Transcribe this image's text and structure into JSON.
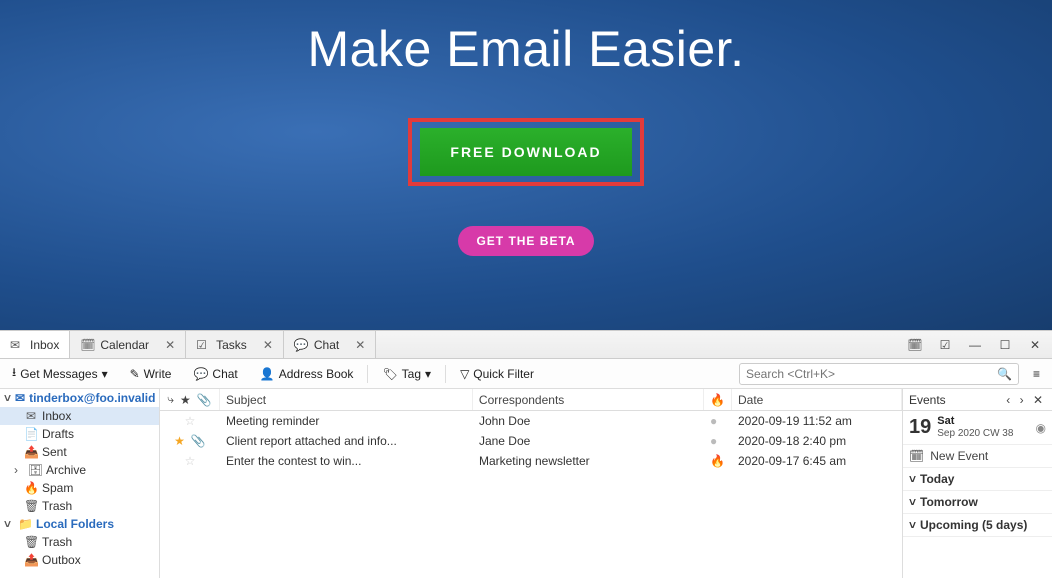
{
  "hero": {
    "title": "Make Email Easier.",
    "download_label": "FREE DOWNLOAD",
    "beta_label": "GET THE BETA"
  },
  "tabs": [
    {
      "label": "Inbox",
      "icon": "mail",
      "active": true,
      "closable": false
    },
    {
      "label": "Calendar",
      "icon": "calendar",
      "active": false,
      "closable": true
    },
    {
      "label": "Tasks",
      "icon": "tasks",
      "active": false,
      "closable": true
    },
    {
      "label": "Chat",
      "icon": "chat",
      "active": false,
      "closable": true
    }
  ],
  "toolbar": {
    "get_messages": "Get Messages",
    "write": "Write",
    "chat": "Chat",
    "address_book": "Address Book",
    "tag": "Tag",
    "quick_filter": "Quick Filter",
    "search_placeholder": "Search <Ctrl+K>"
  },
  "folders": {
    "account": "tinderbox@foo.invalid",
    "items": [
      {
        "label": "Inbox",
        "icon": "mail",
        "selected": true
      },
      {
        "label": "Drafts",
        "icon": "draft",
        "selected": false
      },
      {
        "label": "Sent",
        "icon": "sent",
        "selected": false
      },
      {
        "label": "Archive",
        "icon": "archive",
        "selected": false,
        "expandable": true
      },
      {
        "label": "Spam",
        "icon": "spam",
        "selected": false
      },
      {
        "label": "Trash",
        "icon": "trash",
        "selected": false
      }
    ],
    "local_label": "Local Folders",
    "local_items": [
      {
        "label": "Trash",
        "icon": "trash"
      },
      {
        "label": "Outbox",
        "icon": "outbox"
      }
    ]
  },
  "messages": {
    "columns": {
      "subject": "Subject",
      "correspondents": "Correspondents",
      "date": "Date"
    },
    "rows": [
      {
        "star": false,
        "attach": false,
        "subject": "Meeting reminder",
        "corr": "John Doe",
        "flag": "dim",
        "date": "2020-09-19 11:52 am"
      },
      {
        "star": true,
        "attach": true,
        "subject": "Client report attached and info...",
        "corr": "Jane Doe",
        "flag": "dim",
        "date": "2020-09-18 2:40 pm"
      },
      {
        "star": false,
        "attach": false,
        "subject": "Enter the contest to win...",
        "corr": "Marketing newsletter",
        "flag": "on",
        "date": "2020-09-17 6:45 am"
      }
    ]
  },
  "events": {
    "title": "Events",
    "day": "19",
    "weekday": "Sat",
    "sub": "Sep 2020 CW 38",
    "new_event": "New Event",
    "sections": [
      "Today",
      "Tomorrow",
      "Upcoming (5 days)"
    ]
  }
}
